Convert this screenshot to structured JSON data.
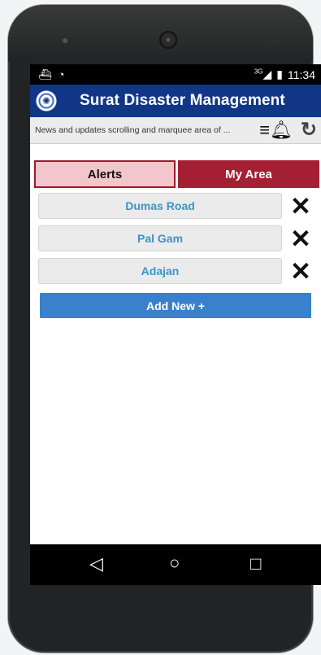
{
  "status_bar": {
    "left_icons": [
      "notification-icon",
      "chat-icon"
    ],
    "network_label": "3G",
    "time": "11:34"
  },
  "app": {
    "title": "Surat Disaster Management",
    "marquee_text": "News and updates scrolling and marquee area of ..."
  },
  "tabs": [
    {
      "label": "Alerts"
    },
    {
      "label": "My Area"
    }
  ],
  "areas": [
    {
      "name": "Dumas Road"
    },
    {
      "name": "Pal Gam"
    },
    {
      "name": "Adajan"
    }
  ],
  "actions": {
    "add_new_label": "Add New +"
  },
  "colors": {
    "primary": "#123686",
    "accent_red": "#a51f34",
    "alerts_tab": "#f3c6cc",
    "add_button": "#3982cb"
  },
  "icons": {
    "bell": "bell-icon",
    "refresh": "refresh-icon",
    "remove": "close-icon",
    "back": "back-icon",
    "home": "home-icon",
    "recents": "recents-icon"
  }
}
